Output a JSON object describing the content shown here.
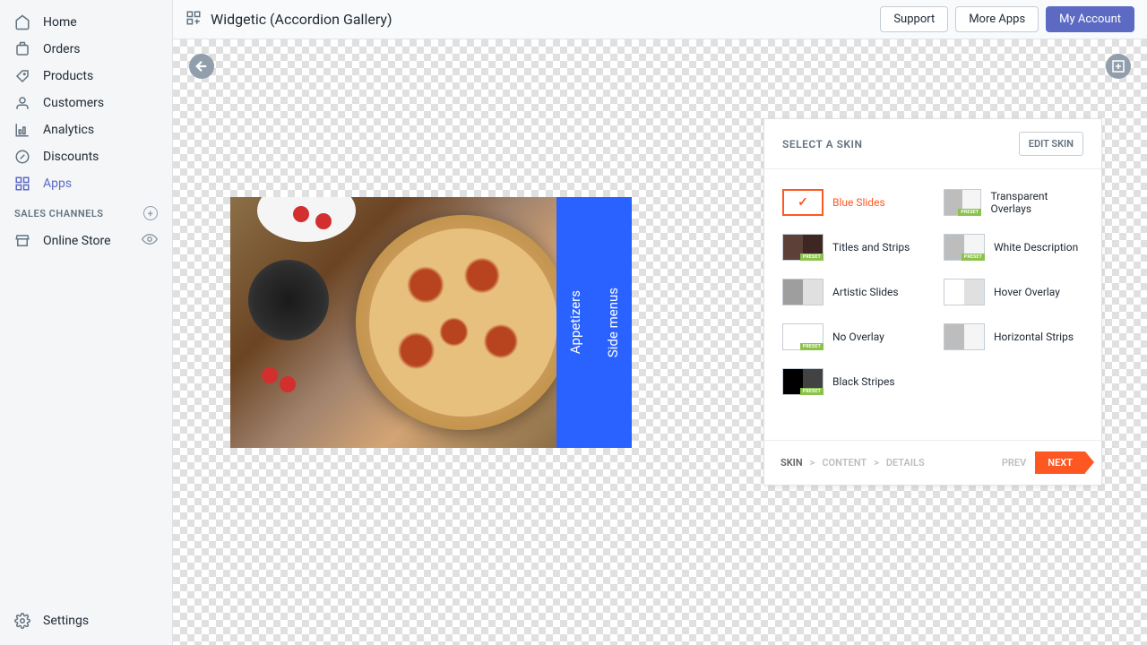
{
  "sidebar": {
    "items": [
      {
        "label": "Home"
      },
      {
        "label": "Orders"
      },
      {
        "label": "Products"
      },
      {
        "label": "Customers"
      },
      {
        "label": "Analytics"
      },
      {
        "label": "Discounts"
      },
      {
        "label": "Apps"
      }
    ],
    "section_label": "SALES CHANNELS",
    "channels": [
      {
        "label": "Online Store"
      }
    ],
    "settings_label": "Settings"
  },
  "header": {
    "app_title": "Widgetic (Accordion Gallery)",
    "buttons": {
      "support": "Support",
      "more_apps": "More Apps",
      "my_account": "My Account"
    }
  },
  "preview": {
    "slides": [
      {
        "label": "Appetizers"
      },
      {
        "label": "Side menus"
      }
    ]
  },
  "panel": {
    "title": "SELECT A SKIN",
    "edit_btn": "EDIT SKIN",
    "skins": [
      {
        "label": "Blue Slides",
        "selected": true,
        "preset": false,
        "th": "white"
      },
      {
        "label": "Transparent Overlays",
        "preset": true,
        "th": "grey-s"
      },
      {
        "label": "Titles and Strips",
        "preset": true,
        "th": "brown"
      },
      {
        "label": "White Description",
        "preset": true,
        "th": "grey-s"
      },
      {
        "label": "Artistic Slides",
        "preset": false,
        "th": "grey-h"
      },
      {
        "label": "Hover Overlay",
        "preset": false,
        "th": "wb"
      },
      {
        "label": "No Overlay",
        "preset": true,
        "th": "white"
      },
      {
        "label": "Horizontal Strips",
        "preset": false,
        "th": "grey-s"
      },
      {
        "label": "Black Stripes",
        "preset": true,
        "th": "black"
      }
    ],
    "footer": {
      "crumbs": [
        "SKIN",
        "CONTENT",
        "DETAILS"
      ],
      "prev": "PREV",
      "next": "NEXT"
    }
  },
  "preset_tag": "PRESET"
}
